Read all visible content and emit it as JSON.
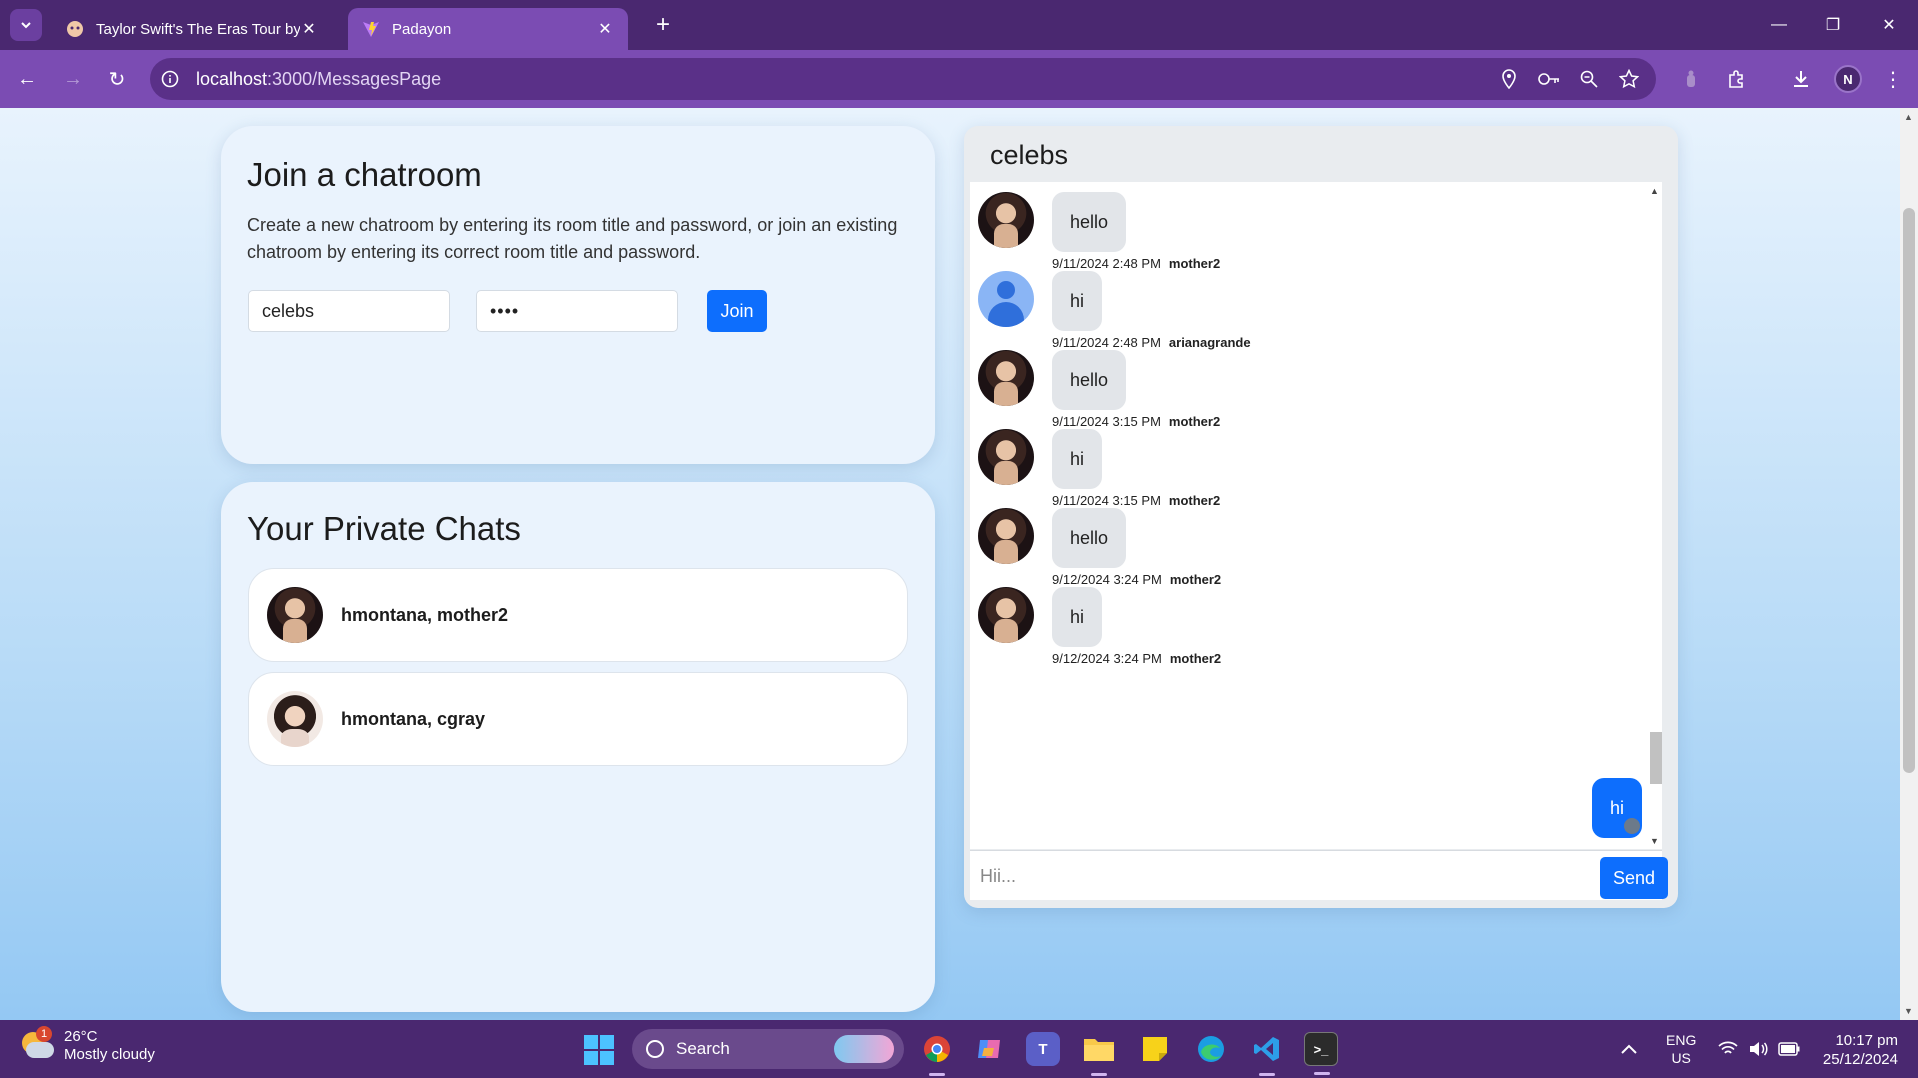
{
  "browser": {
    "tabs": [
      {
        "title": "Taylor Swift's The Eras Tour by N",
        "active": false
      },
      {
        "title": "Padayon",
        "active": true
      }
    ],
    "url_host": "localhost",
    "url_path": ":3000/MessagesPage",
    "profile_initial": "N"
  },
  "join": {
    "title": "Join a chatroom",
    "description": "Create a new chatroom by entering its room title and password, or join an existing chatroom by entering its correct room title and password.",
    "room_value": "celebs",
    "password_value": "••••",
    "join_label": "Join"
  },
  "private_chats": {
    "title": "Your Private Chats",
    "items": [
      {
        "name": "hmontana, mother2",
        "avatar": "taylor"
      },
      {
        "name": "hmontana, cgray",
        "avatar": "cgray"
      }
    ]
  },
  "chat": {
    "room_title": "celebs",
    "messages": [
      {
        "text": "hello",
        "time": "9/11/2024 2:48 PM",
        "user": "mother2",
        "avatar": "taylor"
      },
      {
        "text": "hi",
        "time": "9/11/2024 2:48 PM",
        "user": "arianagrande",
        "avatar": "default"
      },
      {
        "text": "hello",
        "time": "9/11/2024 3:15 PM",
        "user": "mother2",
        "avatar": "taylor"
      },
      {
        "text": "hi",
        "time": "9/11/2024 3:15 PM",
        "user": "mother2",
        "avatar": "taylor"
      },
      {
        "text": "hello",
        "time": "9/12/2024 3:24 PM",
        "user": "mother2",
        "avatar": "taylor"
      },
      {
        "text": "hi",
        "time": "9/12/2024 3:24 PM",
        "user": "mother2",
        "avatar": "taylor"
      }
    ],
    "my_message": "hi",
    "input_placeholder": "Hii...",
    "send_label": "Send"
  },
  "taskbar": {
    "weather_temp": "26°C",
    "weather_desc": "Mostly cloudy",
    "weather_badge": "1",
    "search_label": "Search",
    "lang_1": "ENG",
    "lang_2": "US",
    "time": "10:17 pm",
    "date": "25/12/2024"
  },
  "colors": {
    "chrome_dark": "#4a2870",
    "chrome_light": "#7b4cb3",
    "primary": "#0d6efd"
  }
}
